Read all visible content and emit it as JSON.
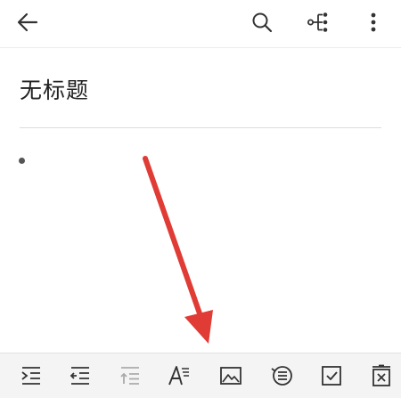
{
  "note": {
    "title": "无标题"
  },
  "colors": {
    "arrow": "#e03b34",
    "icon": "#333333",
    "icon_disabled": "#aaaaaa",
    "toolbar_bg": "#f4f4f4"
  },
  "topbar_icons": [
    "back-arrow-icon",
    "search-icon",
    "mind-map-icon",
    "more-vertical-icon"
  ],
  "toolbar_icons": [
    "indent-icon",
    "outdent-icon",
    "move-up-disabled-icon",
    "text-format-icon",
    "image-icon",
    "bulleted-list-icon",
    "checkbox-icon",
    "delete-box-icon"
  ]
}
